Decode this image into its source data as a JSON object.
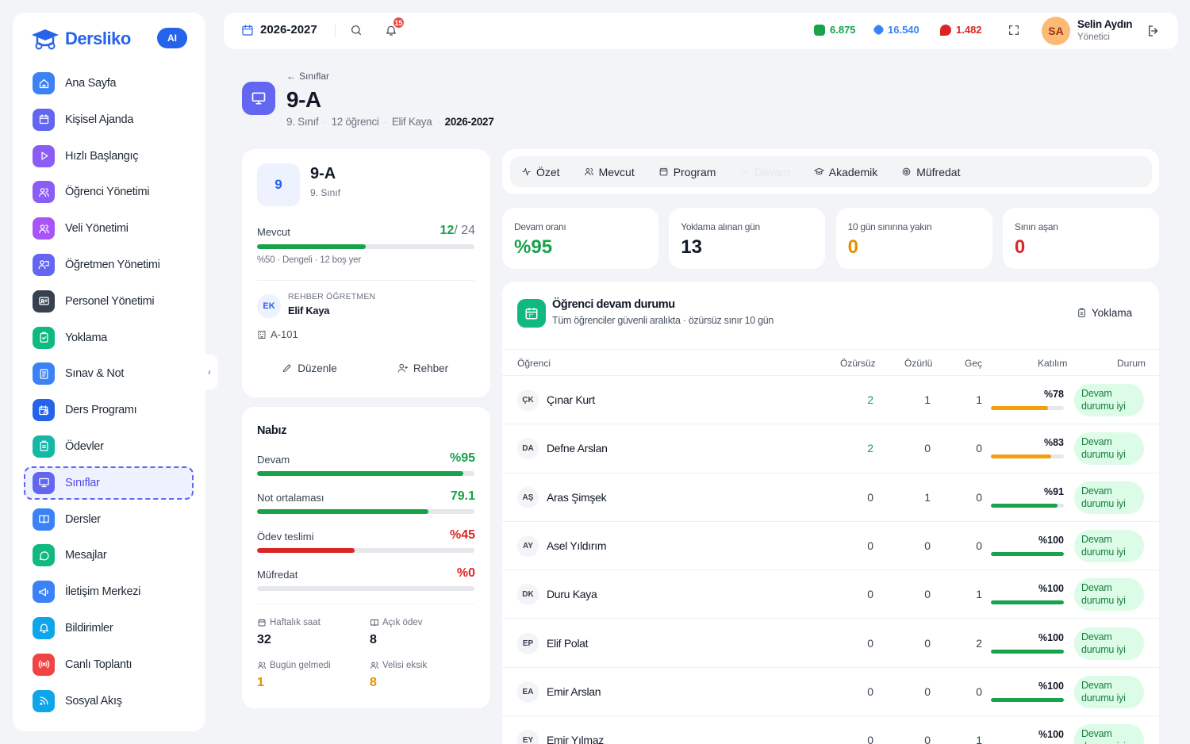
{
  "brand": {
    "name": "Dersliko",
    "ai_label": "AI"
  },
  "sidebar": {
    "items": [
      {
        "label": "Ana Sayfa",
        "icon": "home-icon",
        "color": "#3b82f6"
      },
      {
        "label": "Kişisel Ajanda",
        "icon": "calendar-icon",
        "color": "#6366f1"
      },
      {
        "label": "Hızlı Başlangıç",
        "icon": "play-icon",
        "color": "#8b5cf6"
      },
      {
        "label": "Öğrenci Yönetimi",
        "icon": "users-icon",
        "color": "#8b5cf6"
      },
      {
        "label": "Veli Yönetimi",
        "icon": "users-icon",
        "color": "#a855f7"
      },
      {
        "label": "Öğretmen Yönetimi",
        "icon": "teacher-icon",
        "color": "#6366f1"
      },
      {
        "label": "Personel Yönetimi",
        "icon": "id-card-icon",
        "color": "#374151"
      },
      {
        "label": "Yoklama",
        "icon": "clipboard-check-icon",
        "color": "#10b981"
      },
      {
        "label": "Sınav & Not",
        "icon": "document-icon",
        "color": "#3b82f6"
      },
      {
        "label": "Ders Programı",
        "icon": "calendar-clock-icon",
        "color": "#2563eb"
      },
      {
        "label": "Ödevler",
        "icon": "clipboard-icon",
        "color": "#14b8a6"
      },
      {
        "label": "Sınıflar",
        "icon": "presentation-icon",
        "color": "#6366f1",
        "active": true
      },
      {
        "label": "Dersler",
        "icon": "book-icon",
        "color": "#3b82f6"
      },
      {
        "label": "Mesajlar",
        "icon": "message-icon",
        "color": "#10b981"
      },
      {
        "label": "İletişim Merkezi",
        "icon": "megaphone-icon",
        "color": "#3b82f6"
      },
      {
        "label": "Bildirimler",
        "icon": "bell-icon",
        "color": "#0ea5e9"
      },
      {
        "label": "Canlı Toplantı",
        "icon": "broadcast-icon",
        "color": "#ef4444"
      },
      {
        "label": "Sosyal Akış",
        "icon": "rss-icon",
        "color": "#0ea5e9"
      }
    ]
  },
  "topbar": {
    "year": "2026-2027",
    "notification_count": "15",
    "stats": [
      {
        "value": "6.875",
        "color": "#16a34a",
        "icon": "coin-icon"
      },
      {
        "value": "16.540",
        "color": "#3b82f6",
        "icon": "diamond-icon"
      },
      {
        "value": "1.482",
        "color": "#dc2626",
        "icon": "fire-icon"
      }
    ],
    "user": {
      "initials": "SA",
      "name": "Selin Aydın",
      "role": "Yönetici"
    }
  },
  "header": {
    "breadcrumb": "Sınıflar",
    "title": "9-A",
    "meta": {
      "grade": "9. Sınıf",
      "students": "12 öğrenci",
      "teacher": "Elif Kaya",
      "year": "2026-2027"
    }
  },
  "class_card": {
    "badge": "9",
    "title": "9-A",
    "subtitle": "9. Sınıf",
    "present_label": "Mevcut",
    "present": "12",
    "capacity": "/ 24",
    "fill_ratio": 0.5,
    "note": "%50 · Dengeli · 12 boş yer",
    "teacher_label": "REHBER ÖĞRETMEN",
    "teacher_initials": "EK",
    "teacher_name": "Elif Kaya",
    "room": "A-101",
    "edit_label": "Düzenle",
    "guide_label": "Rehber"
  },
  "pulse": {
    "title": "Nabız",
    "metrics": [
      {
        "label": "Devam",
        "value": "%95",
        "ratio": 0.95,
        "color": "#16a34a"
      },
      {
        "label": "Not ortalaması",
        "value": "79.1",
        "ratio": 0.79,
        "color": "#16a34a"
      },
      {
        "label": "Ödev teslimi",
        "value": "%45",
        "ratio": 0.45,
        "color": "#dc2626"
      },
      {
        "label": "Müfredat",
        "value": "%0",
        "ratio": 0.0,
        "color": "#dc2626"
      }
    ],
    "mini": [
      {
        "label": "Haftalık saat",
        "value": "32",
        "color": "#111827",
        "icon": "calendar-icon"
      },
      {
        "label": "Açık ödev",
        "value": "8",
        "color": "#111827",
        "icon": "book-icon"
      },
      {
        "label": "Bugün gelmedi",
        "value": "1",
        "color": "#ea8c00",
        "icon": "users-icon"
      },
      {
        "label": "Velisi eksik",
        "value": "8",
        "color": "#ea8c00",
        "icon": "users-icon"
      }
    ]
  },
  "tabs": [
    {
      "label": "Özet",
      "icon": "pulse-icon"
    },
    {
      "label": "Mevcut",
      "icon": "users-icon"
    },
    {
      "label": "Program",
      "icon": "calendar-icon"
    },
    {
      "label": "Devam",
      "icon": "check-icon",
      "dim": true
    },
    {
      "label": "Akademik",
      "icon": "cap-icon"
    },
    {
      "label": "Müfredat",
      "icon": "target-icon"
    }
  ],
  "kpis": [
    {
      "label": "Devam oranı",
      "value": "%95",
      "color": "#16a34a"
    },
    {
      "label": "Yoklama alınan gün",
      "value": "13",
      "color": "#111827"
    },
    {
      "label": "10 gün sınırına yakın",
      "value": "0",
      "color": "#ea8c00"
    },
    {
      "label": "Sınırı aşan",
      "value": "0",
      "color": "#dc2626"
    }
  ],
  "attendance": {
    "title": "Öğrenci devam durumu",
    "subtitle": "Tüm öğrenciler güvenli aralıkta · özürsüz sınır 10 gün",
    "button": "Yoklama",
    "columns": [
      "Öğrenci",
      "Özürsüz",
      "Özürlü",
      "Geç",
      "Katılım",
      "Durum"
    ],
    "rows": [
      {
        "initials": "ÇK",
        "name": "Çınar Kurt",
        "unexcused": "2",
        "excused": "1",
        "late": "1",
        "rate": "%78",
        "ratio": 0.78,
        "status": "Devam durumu iyi"
      },
      {
        "initials": "DA",
        "name": "Defne Arslan",
        "unexcused": "2",
        "excused": "0",
        "late": "0",
        "rate": "%83",
        "ratio": 0.83,
        "status": "Devam durumu iyi"
      },
      {
        "initials": "AŞ",
        "name": "Aras Şimşek",
        "unexcused": "0",
        "excused": "1",
        "late": "0",
        "rate": "%91",
        "ratio": 0.91,
        "status": "Devam durumu iyi"
      },
      {
        "initials": "AY",
        "name": "Asel Yıldırım",
        "unexcused": "0",
        "excused": "0",
        "late": "0",
        "rate": "%100",
        "ratio": 1.0,
        "status": "Devam durumu iyi"
      },
      {
        "initials": "DK",
        "name": "Duru Kaya",
        "unexcused": "0",
        "excused": "0",
        "late": "1",
        "rate": "%100",
        "ratio": 1.0,
        "status": "Devam durumu iyi"
      },
      {
        "initials": "EP",
        "name": "Elif Polat",
        "unexcused": "0",
        "excused": "0",
        "late": "2",
        "rate": "%100",
        "ratio": 1.0,
        "status": "Devam durumu iyi"
      },
      {
        "initials": "EA",
        "name": "Emir Arslan",
        "unexcused": "0",
        "excused": "0",
        "late": "0",
        "rate": "%100",
        "ratio": 1.0,
        "status": "Devam durumu iyi"
      },
      {
        "initials": "EY",
        "name": "Emir Yılmaz",
        "unexcused": "0",
        "excused": "0",
        "late": "1",
        "rate": "%100",
        "ratio": 1.0,
        "status": "Devam durumu iyi"
      }
    ]
  }
}
